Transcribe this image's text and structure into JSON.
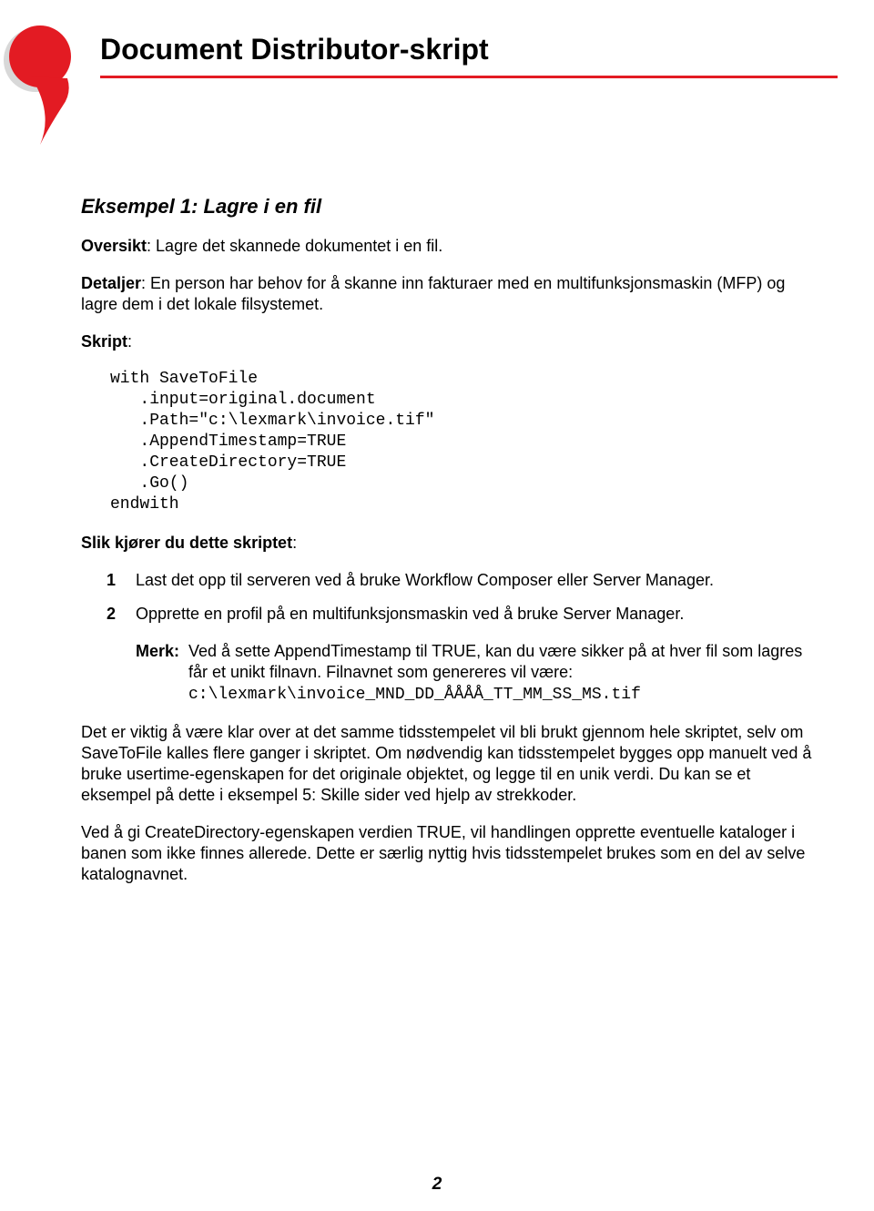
{
  "header": {
    "title": "Document Distributor-skript"
  },
  "example": {
    "heading": "Eksempel 1: Lagre i en fil",
    "overview_label": "Oversikt",
    "overview_text": ": Lagre det skannede dokumentet i en fil.",
    "details_label": "Detaljer",
    "details_text": ": En person har behov for å skanne inn fakturaer med en multifunksjonsmaskin (MFP) og lagre dem i det lokale filsystemet.",
    "script_label": "Skript",
    "script_colon": ":",
    "code": "with SaveToFile\n   .input=original.document\n   .Path=\"c:\\lexmark\\invoice.tif\"\n   .AppendTimestamp=TRUE\n   .CreateDirectory=TRUE\n   .Go()\nendwith",
    "howto_label": "Slik kjører du dette skriptet",
    "steps": [
      "Last det opp til serveren ved å bruke Workflow Composer eller Server Manager.",
      "Opprette en profil på en multifunksjonsmaskin ved å bruke Server Manager."
    ],
    "note_label": "Merk:",
    "note_text": "Ved å sette AppendTimestamp til TRUE, kan du være sikker på at hver fil som lagres får et unikt filnavn. Filnavnet som genereres vil være:",
    "note_code": "c:\\lexmark\\invoice_MND_DD_ÅÅÅÅ_TT_MM_SS_MS.tif",
    "body1": "Det er viktig å være klar over at det samme tidsstempelet vil bli brukt gjennom hele skriptet, selv om SaveToFile kalles flere ganger i skriptet. Om nødvendig kan tidsstempelet bygges opp manuelt ved å bruke usertime-egenskapen for det originale objektet, og legge til en unik verdi. Du kan se et eksempel på dette i eksempel 5: Skille sider ved hjelp av strekkoder.",
    "body2": "Ved å gi CreateDirectory-egenskapen verdien TRUE, vil handlingen opprette eventuelle kataloger i banen som ikke finnes allerede. Dette er særlig nyttig hvis tidsstempelet brukes som en del av selve katalognavnet."
  },
  "page_number": "2"
}
